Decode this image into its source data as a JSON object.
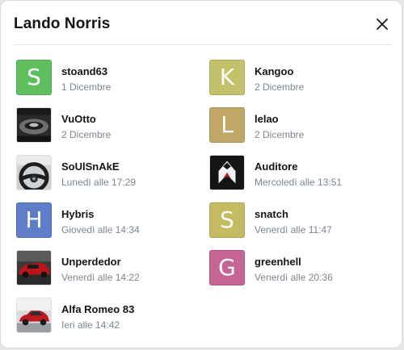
{
  "dialog": {
    "title": "Lando Norris",
    "close_icon": "close-icon"
  },
  "users": [
    {
      "name": "stoand63",
      "date": "1 Dicembre",
      "avatar_letter": "S",
      "avatar_color": "#5fbf5f"
    },
    {
      "name": "Kangoo",
      "date": "2 Dicembre",
      "avatar_letter": "K",
      "avatar_color": "#c3c16a"
    },
    {
      "name": "VuOtto",
      "date": "2 Dicembre",
      "avatar_photo": "car-interior-dark-photo"
    },
    {
      "name": "lelao",
      "date": "2 Dicembre",
      "avatar_letter": "L",
      "avatar_color": "#c1a765"
    },
    {
      "name": "SoUlSnAkE",
      "date": "Lunedì alle 17:29",
      "avatar_photo": "steering-wheel-photo"
    },
    {
      "name": "Auditore",
      "date": "Mercoledì alle 13:51",
      "avatar_photo": "hooded-assassin-logo"
    },
    {
      "name": "Hybris",
      "date": "Giovedì alle 14:34",
      "avatar_letter": "H",
      "avatar_color": "#5e7ec9"
    },
    {
      "name": "snatch",
      "date": "Venerdì alle 11:47",
      "avatar_letter": "S",
      "avatar_color": "#c5bb62"
    },
    {
      "name": "Unperdedor",
      "date": "Venerdì alle 14:22",
      "avatar_photo": "red-race-car-photo"
    },
    {
      "name": "greenhell",
      "date": "Venerdì alle 20:36",
      "avatar_letter": "G",
      "avatar_color": "#c46596"
    },
    {
      "name": "Alfa Romeo 83",
      "date": "Ieri alle 14:42",
      "avatar_photo": "red-sedan-photo"
    }
  ]
}
